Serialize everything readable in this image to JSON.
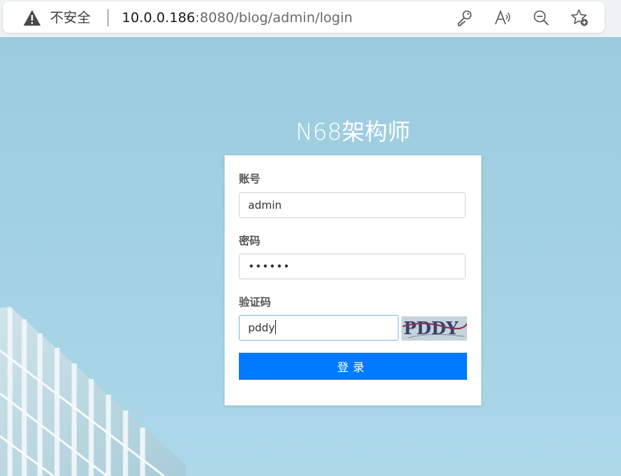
{
  "browser": {
    "insecure_label": "不安全",
    "url_host": "10.0.0.186",
    "url_rest": ":8080/blog/admin/login",
    "icons": [
      "warning-icon",
      "key-icon",
      "read-aloud-icon",
      "zoom-out-icon",
      "add-favorite-icon"
    ]
  },
  "login": {
    "site_title": "N68架构师",
    "account_label": "账号",
    "account_value": "admin",
    "password_label": "密码",
    "password_value": "••••••",
    "captcha_label": "验证码",
    "captcha_value": "pddy",
    "captcha_image_text": "PDDY",
    "submit_label": "登录"
  },
  "colors": {
    "primary": "#007bff",
    "background": "#9fcde0",
    "title": "#ffffff"
  }
}
